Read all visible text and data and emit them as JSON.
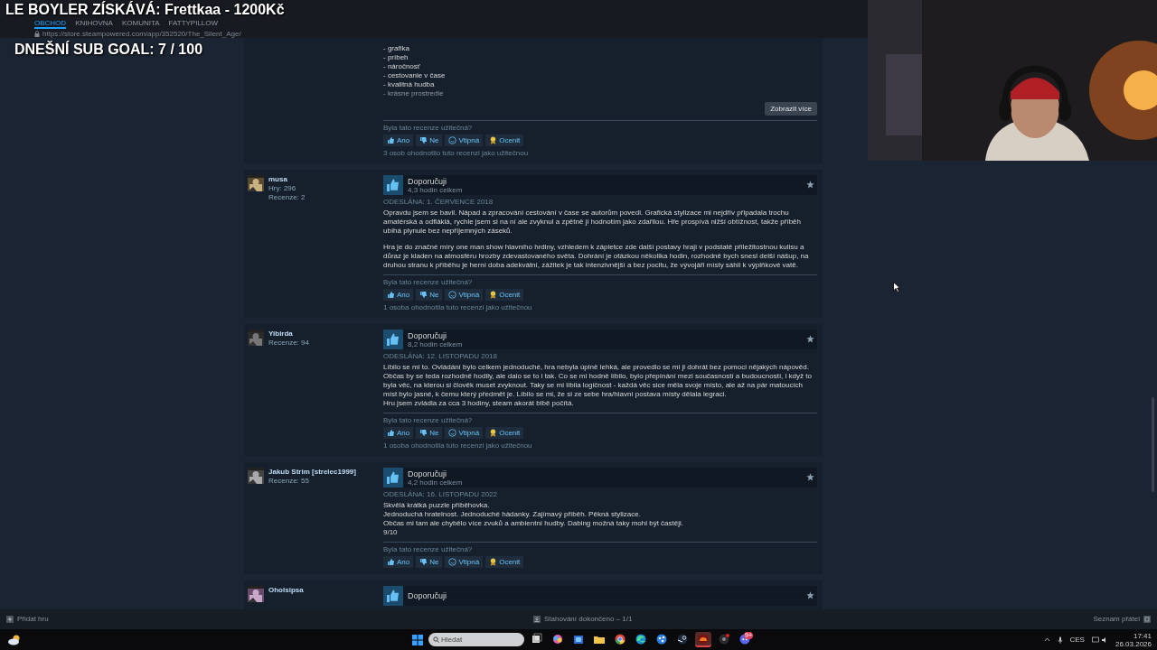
{
  "overlay": {
    "donation": "LE BOYLER ZÍSKÁVÁ: Frettkaa - 1200Kč",
    "sub_goal": "DNEŠNÍ SUB GOAL: 7 / 100"
  },
  "nav_tabs": [
    {
      "label": "OBCHOD",
      "selected": true
    },
    {
      "label": "KNIHOVNA",
      "selected": false
    },
    {
      "label": "KOMUNITA",
      "selected": false
    },
    {
      "label": "FATTYPILLOW",
      "selected": false
    }
  ],
  "url": "https://store.steampowered.com/app/352520/The_Silent_Age/",
  "reviews": [
    {
      "body": [
        "- grafika\n- príbeh\n- náročnosť\n- cestovanie v čase\n- kvalitná hudba\n- krásne prostredie"
      ],
      "show_more": "Zobrazit více",
      "helpful_question": "Byla tato recenze užitečná?",
      "votes": [
        {
          "kind": "yes",
          "label": "Ano"
        },
        {
          "kind": "no",
          "label": "Ne"
        },
        {
          "kind": "funny",
          "label": "Vtipná"
        },
        {
          "kind": "award",
          "label": "Ocenit"
        }
      ],
      "helpful_count": "3 osob ohodnotilo tuto recenzi jako užitečnou"
    },
    {
      "author": "musa",
      "stats": [
        "Hry: 296",
        "Recenze: 2"
      ],
      "verdict": "Doporučuji",
      "hours": "4,3 hodin celkem",
      "date": "ODESLÁNA: 1. ČERVENCE 2018",
      "body": [
        "Opravdu jsem se bavil. Nápad a zpracování cestování v čase se autorům povedl. Grafická stylizace mi nejdřív připadala trochu amatérská a odfláklá, rychle jsem si na ní ale zvyknul a zpětně ji hodnotím jako zdařilou. Hře prospívá nižší obtížnost, takže příběh ubíhá plynule bez nepříjemných záseků.",
        "Hra je do značné míry one man show hlavního hrdiny, vzhledem k zápletce zde další postavy hrají v podstatě příležitostnou kulisu a důraz je kladen na atmosféru hrozby zdevastovaného světa. Dohrání je otázkou několika hodin, rozhodně bych snesl delší nášup, na druhou stranu k příběhu je herní doba adekvátní, zážitek je tak intenzivnější a bez pocitu, že vývojáři místy sáhli k výplňkové vatě."
      ],
      "helpful_question": "Byla tato recenze užitečná?",
      "votes": [
        {
          "kind": "yes",
          "label": "Ano"
        },
        {
          "kind": "no",
          "label": "Ne"
        },
        {
          "kind": "funny",
          "label": "Vtipná"
        },
        {
          "kind": "award",
          "label": "Ocenit"
        }
      ],
      "helpful_count": "1 osoba ohodnotila tuto recenzi jako užitečnou"
    },
    {
      "author": "Yibirda",
      "stats": [
        "Recenze: 94"
      ],
      "verdict": "Doporučuji",
      "hours": "8,2 hodin celkem",
      "date": "ODESLÁNA: 12. LISTOPADU 2018",
      "body": [
        "Líbilo se mi to. Ovládání bylo celkem jednoduché, hra nebyla úplně lehká, ale provedlo se mi ji dohrát bez pomoci nějakých nápověd. Občas by se teda rozhodně hodily, ale dalo se to i tak. Co se mi hodně líbilo, bylo přepínání mezi současností a budoucností, i když to byla věc, na kterou si člověk muset zvyknout. Taky se mi líbila logičnost - každá věc sice měla svoje místo, ale až na pár matoucích míst bylo jasné, k čemu který předmět je. Líbilo se mi, že si ze sebe hra/hlavní postava místy dělala legraci.\nHru jsem zvládla za cca 3 hodiny, steam akorát blbě počítá."
      ],
      "helpful_question": "Byla tato recenze užitečná?",
      "votes": [
        {
          "kind": "yes",
          "label": "Ano"
        },
        {
          "kind": "no",
          "label": "Ne"
        },
        {
          "kind": "funny",
          "label": "Vtipná"
        },
        {
          "kind": "award",
          "label": "Ocenit"
        }
      ],
      "helpful_count": "1 osoba ohodnotila tuto recenzi jako užitečnou"
    },
    {
      "author": "Jakub Strim [strelec1999]",
      "stats": [
        "Recenze: 55"
      ],
      "verdict": "Doporučuji",
      "hours": "4,2 hodin celkem",
      "date": "ODESLÁNA: 16. LISTOPADU 2022",
      "body": [
        "Skvělá krátká puzzle příběhovka.\nJednoduchá hratelnost. Jednoduché hádanky. Zajímavý příběh. Pěkná stylizace.\nObčas mi tam ale chybělo více zvuků a ambientní hudby. Dabing možná taky mohl být častěji.\n9/10"
      ],
      "helpful_question": "Byla tato recenze užitečná?",
      "votes": [
        {
          "kind": "yes",
          "label": "Ano"
        },
        {
          "kind": "no",
          "label": "Ne"
        },
        {
          "kind": "funny",
          "label": "Vtipná"
        },
        {
          "kind": "award",
          "label": "Ocenit"
        }
      ]
    },
    {
      "author": "Oholsipsa",
      "verdict": "Doporučuji"
    }
  ],
  "steam_bar": {
    "add_game": "Přidat hru",
    "downloads": "Stahování dokončeno – 1/1",
    "friends": "Seznam přátel"
  },
  "taskbar": {
    "search_placeholder": "Hledat",
    "apps": [
      {
        "kind": "taskview",
        "selected": false
      },
      {
        "kind": "copilot",
        "selected": false
      },
      {
        "kind": "store",
        "selected": false
      },
      {
        "kind": "folder",
        "selected": false
      },
      {
        "kind": "chrome",
        "selected": false
      },
      {
        "kind": "edge",
        "selected": false
      },
      {
        "kind": "share",
        "selected": false
      },
      {
        "kind": "steam",
        "selected": false
      },
      {
        "kind": "game",
        "selected": true
      },
      {
        "kind": "record",
        "selected": false
      },
      {
        "kind": "discord",
        "selected": false,
        "badge": "9+"
      }
    ],
    "language": "CES",
    "time": "17:41",
    "date": "26.03.2026"
  }
}
